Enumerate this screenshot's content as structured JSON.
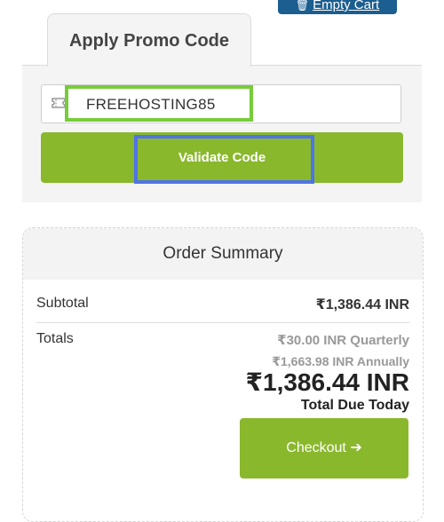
{
  "header": {
    "empty_cart_label": "Empty Cart"
  },
  "promo": {
    "tab_label": "Apply Promo Code",
    "code_value": "FREEHOSTING85",
    "validate_label": "Validate Code"
  },
  "summary": {
    "title": "Order Summary",
    "subtotal_label": "Subtotal",
    "subtotal_value": "₹1,386.44 INR",
    "totals_label": "Totals",
    "recurring_quarterly": "₹30.00 INR Quarterly",
    "recurring_annually": "₹1,663.98 INR Annually",
    "total_due": "₹1,386.44 INR",
    "total_due_label": "Total Due Today",
    "checkout_label": "Checkout",
    "checkout_arrow": "➔"
  },
  "colors": {
    "accent_green": "#8ab82d",
    "header_blue": "#1b5e8f",
    "highlight_green": "#77cc3a",
    "highlight_blue": "#4f73e8"
  },
  "icons": [
    "trash-icon",
    "ticket-icon",
    "arrow-right-icon"
  ]
}
